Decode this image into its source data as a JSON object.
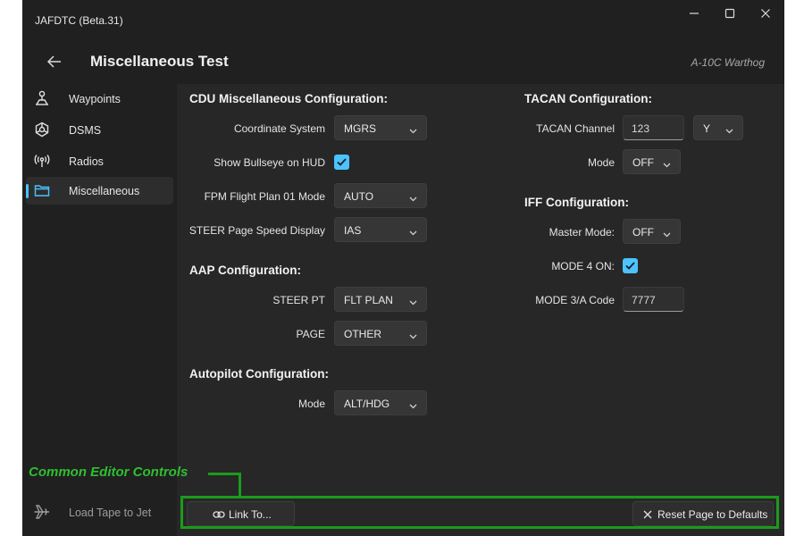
{
  "window": {
    "title": "JAFDTC (Beta.31)",
    "controls": [
      "minimize",
      "maximize",
      "close"
    ]
  },
  "header": {
    "page_title": "Miscellaneous Test",
    "aircraft": "A-10C Warthog",
    "back_icon": "back-arrow-icon"
  },
  "sidebar": {
    "items": [
      {
        "label": "Waypoints",
        "icon": "waypoint-icon",
        "selected": false
      },
      {
        "label": "DSMS",
        "icon": "dsms-icon",
        "selected": false
      },
      {
        "label": "Radios",
        "icon": "radio-icon",
        "selected": false
      },
      {
        "label": "Miscellaneous",
        "icon": "folder-icon",
        "selected": true
      }
    ],
    "load_tape": {
      "label": "Load Tape to Jet",
      "icon": "airplane-icon"
    }
  },
  "cdu": {
    "title": "CDU Miscellaneous Configuration:",
    "coord_label": "Coordinate System",
    "coord_value": "MGRS",
    "bullseye_label": "Show Bullseye on HUD",
    "bullseye_checked": true,
    "fpm_label": "FPM Flight Plan 01 Mode",
    "fpm_value": "AUTO",
    "steer_speed_label": "STEER Page Speed Display",
    "steer_speed_value": "IAS"
  },
  "aap": {
    "title": "AAP Configuration:",
    "steer_pt_label": "STEER PT",
    "steer_pt_value": "FLT PLAN",
    "page_label": "PAGE",
    "page_value": "OTHER"
  },
  "autopilot": {
    "title": "Autopilot Configuration:",
    "mode_label": "Mode",
    "mode_value": "ALT/HDG"
  },
  "tacan": {
    "title": "TACAN Configuration:",
    "channel_label": "TACAN Channel",
    "channel_value": "123",
    "band_value": "Y",
    "mode_label": "Mode",
    "mode_value": "OFF"
  },
  "iff": {
    "title": "IFF Configuration:",
    "master_label": "Master Mode:",
    "master_value": "OFF",
    "mode4_label": "MODE 4 ON:",
    "mode4_checked": true,
    "mode3a_label": "MODE 3/A Code",
    "mode3a_value": "7777"
  },
  "footer": {
    "link_label": "Link To...",
    "link_icon": "link-icon",
    "reset_label": "Reset Page to Defaults",
    "reset_icon": "close-icon"
  },
  "annotation": {
    "label": "Common Editor Controls"
  },
  "colors": {
    "accent": "#4cc2ff",
    "annotation": "#2fbf2f",
    "highlight_border": "#1b9b1b",
    "window_bg": "#202020",
    "content_bg": "#272727"
  }
}
